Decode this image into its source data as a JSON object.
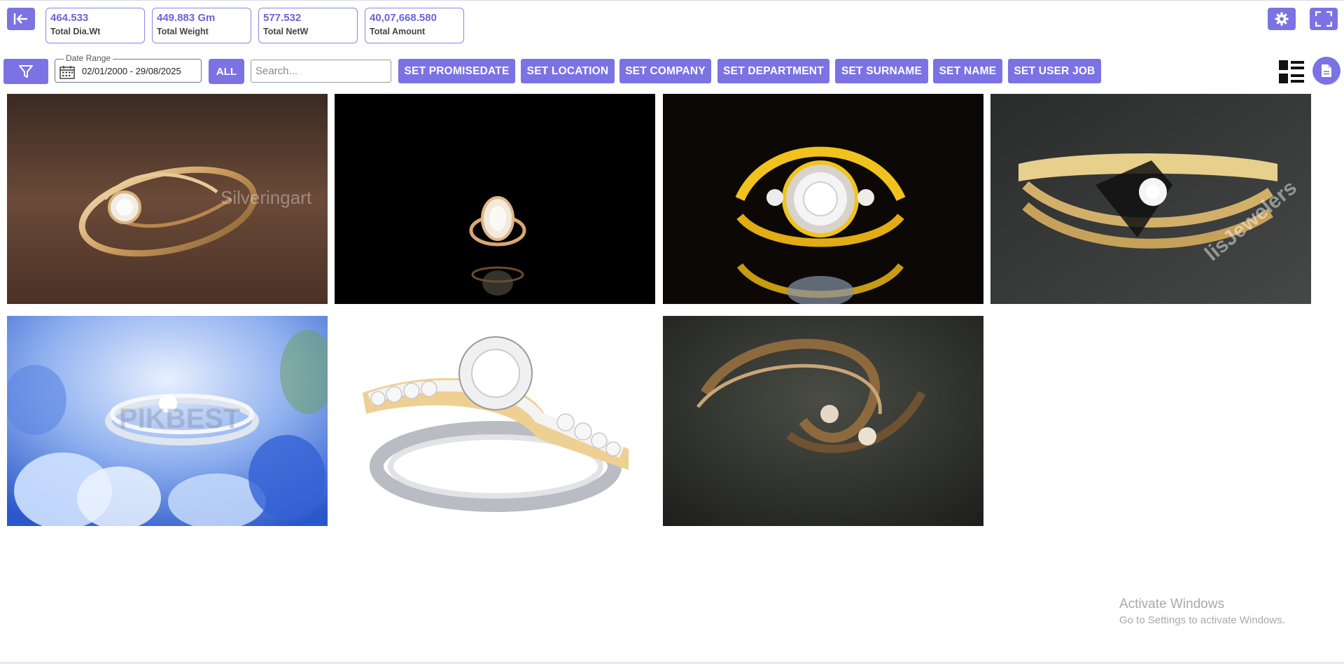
{
  "stats": [
    {
      "value": "464.533",
      "label": "Total Dia.Wt"
    },
    {
      "value": "449.883 Gm",
      "label": "Total Weight"
    },
    {
      "value": "577.532",
      "label": "Total NetW"
    },
    {
      "value": "40,07,668.580",
      "label": "Total Amount"
    }
  ],
  "toolbar": {
    "date_range_legend": "Date Range",
    "date_range_value": "02/01/2000 - 29/08/2025",
    "all_label": "ALL",
    "search_placeholder": "Search...",
    "set_buttons": [
      "SET PROMISEDATE",
      "SET LOCATION",
      "SET COMPANY",
      "SET DEPARTMENT",
      "SET SURNAME",
      "SET NAME",
      "SET USER JOB"
    ]
  },
  "gallery": {
    "items": [
      {
        "watermark": "Silveringart"
      },
      {
        "watermark": ""
      },
      {
        "watermark": ""
      },
      {
        "watermark": "lisJewelers"
      },
      {
        "watermark": "PIKBEST"
      },
      {
        "watermark": ""
      },
      {
        "watermark": ""
      }
    ]
  },
  "os_overlay": {
    "title": "Activate Windows",
    "subtitle": "Go to Settings to activate Windows."
  },
  "icons": {
    "back": "collapse-left-icon",
    "settings": "gear-icon",
    "fullscreen": "fullscreen-icon",
    "filter": "filter-icon",
    "calendar": "calendar-icon",
    "view_toggle": "list-view-icon",
    "report": "document-icon"
  },
  "colors": {
    "accent": "#7b73e3",
    "stat_value": "#6c63d9"
  }
}
